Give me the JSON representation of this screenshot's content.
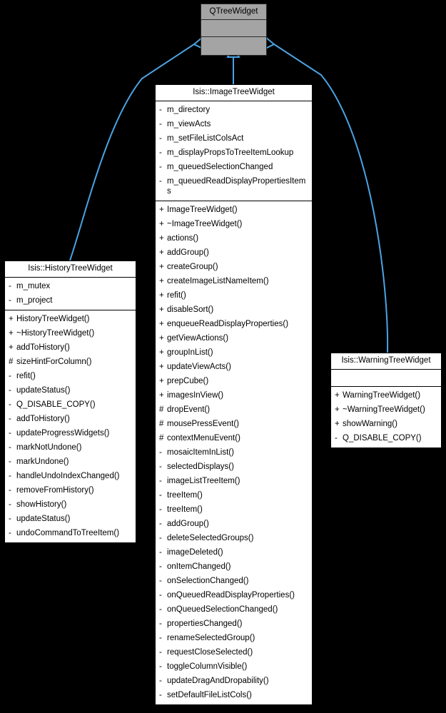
{
  "diagram": {
    "type": "uml-class-inheritance",
    "background": "#000000",
    "edge_color": "#4ba3e3",
    "base_fill": "#a4a4a4",
    "derived_fill": "#ffffff"
  },
  "classes": {
    "base": {
      "name": "QTreeWidget",
      "attributes": [],
      "methods": []
    },
    "history": {
      "name": "Isis::HistoryTreeWidget",
      "attributes": [
        {
          "vis": "-",
          "name": "m_mutex"
        },
        {
          "vis": "-",
          "name": "m_project"
        }
      ],
      "methods": [
        {
          "vis": "+",
          "name": "HistoryTreeWidget()"
        },
        {
          "vis": "+",
          "name": "~HistoryTreeWidget()"
        },
        {
          "vis": "+",
          "name": "addToHistory()"
        },
        {
          "vis": "#",
          "name": "sizeHintForColumn()"
        },
        {
          "vis": "-",
          "name": "refit()"
        },
        {
          "vis": "-",
          "name": "updateStatus()"
        },
        {
          "vis": "-",
          "name": "Q_DISABLE_COPY()"
        },
        {
          "vis": "-",
          "name": "addToHistory()"
        },
        {
          "vis": "-",
          "name": "updateProgressWidgets()"
        },
        {
          "vis": "-",
          "name": "markNotUndone()"
        },
        {
          "vis": "-",
          "name": "markUndone()"
        },
        {
          "vis": "-",
          "name": "handleUndoIndexChanged()"
        },
        {
          "vis": "-",
          "name": "removeFromHistory()"
        },
        {
          "vis": "-",
          "name": "showHistory()"
        },
        {
          "vis": "-",
          "name": "updateStatus()"
        },
        {
          "vis": "-",
          "name": "undoCommandToTreeItem()"
        }
      ]
    },
    "image": {
      "name": "Isis::ImageTreeWidget",
      "attributes": [
        {
          "vis": "-",
          "name": "m_directory"
        },
        {
          "vis": "-",
          "name": "m_viewActs"
        },
        {
          "vis": "-",
          "name": "m_setFileListColsAct"
        },
        {
          "vis": "-",
          "name": "m_displayPropsToTreeItemLookup"
        },
        {
          "vis": "-",
          "name": "m_queuedSelectionChanged"
        },
        {
          "vis": "-",
          "name": "m_queuedReadDisplayPropertiesItems"
        }
      ],
      "methods": [
        {
          "vis": "+",
          "name": "ImageTreeWidget()"
        },
        {
          "vis": "+",
          "name": "~ImageTreeWidget()"
        },
        {
          "vis": "+",
          "name": "actions()"
        },
        {
          "vis": "+",
          "name": "addGroup()"
        },
        {
          "vis": "+",
          "name": "createGroup()"
        },
        {
          "vis": "+",
          "name": "createImageListNameItem()"
        },
        {
          "vis": "+",
          "name": "refit()"
        },
        {
          "vis": "+",
          "name": "disableSort()"
        },
        {
          "vis": "+",
          "name": "enqueueReadDisplayProperties()"
        },
        {
          "vis": "+",
          "name": "getViewActions()"
        },
        {
          "vis": "+",
          "name": "groupInList()"
        },
        {
          "vis": "+",
          "name": "updateViewActs()"
        },
        {
          "vis": "+",
          "name": "prepCube()"
        },
        {
          "vis": "+",
          "name": "imagesInView()"
        },
        {
          "vis": "#",
          "name": "dropEvent()"
        },
        {
          "vis": "#",
          "name": "mousePressEvent()"
        },
        {
          "vis": "#",
          "name": "contextMenuEvent()"
        },
        {
          "vis": "-",
          "name": "mosaicItemInList()"
        },
        {
          "vis": "-",
          "name": "selectedDisplays()"
        },
        {
          "vis": "-",
          "name": "imageListTreeItem()"
        },
        {
          "vis": "-",
          "name": "treeItem()"
        },
        {
          "vis": "-",
          "name": "treeItem()"
        },
        {
          "vis": "-",
          "name": "addGroup()"
        },
        {
          "vis": "-",
          "name": "deleteSelectedGroups()"
        },
        {
          "vis": "-",
          "name": "imageDeleted()"
        },
        {
          "vis": "-",
          "name": "onItemChanged()"
        },
        {
          "vis": "-",
          "name": "onSelectionChanged()"
        },
        {
          "vis": "-",
          "name": "onQueuedReadDisplayProperties()"
        },
        {
          "vis": "-",
          "name": "onQueuedSelectionChanged()"
        },
        {
          "vis": "-",
          "name": "propertiesChanged()"
        },
        {
          "vis": "-",
          "name": "renameSelectedGroup()"
        },
        {
          "vis": "-",
          "name": "requestCloseSelected()"
        },
        {
          "vis": "-",
          "name": "toggleColumnVisible()"
        },
        {
          "vis": "-",
          "name": "updateDragAndDropability()"
        },
        {
          "vis": "-",
          "name": "setDefaultFileListCols()"
        }
      ]
    },
    "warning": {
      "name": "Isis::WarningTreeWidget",
      "attributes": [],
      "methods": [
        {
          "vis": "+",
          "name": "WarningTreeWidget()"
        },
        {
          "vis": "+",
          "name": "~WarningTreeWidget()"
        },
        {
          "vis": "+",
          "name": "showWarning()"
        },
        {
          "vis": "-",
          "name": "Q_DISABLE_COPY()"
        }
      ]
    }
  }
}
